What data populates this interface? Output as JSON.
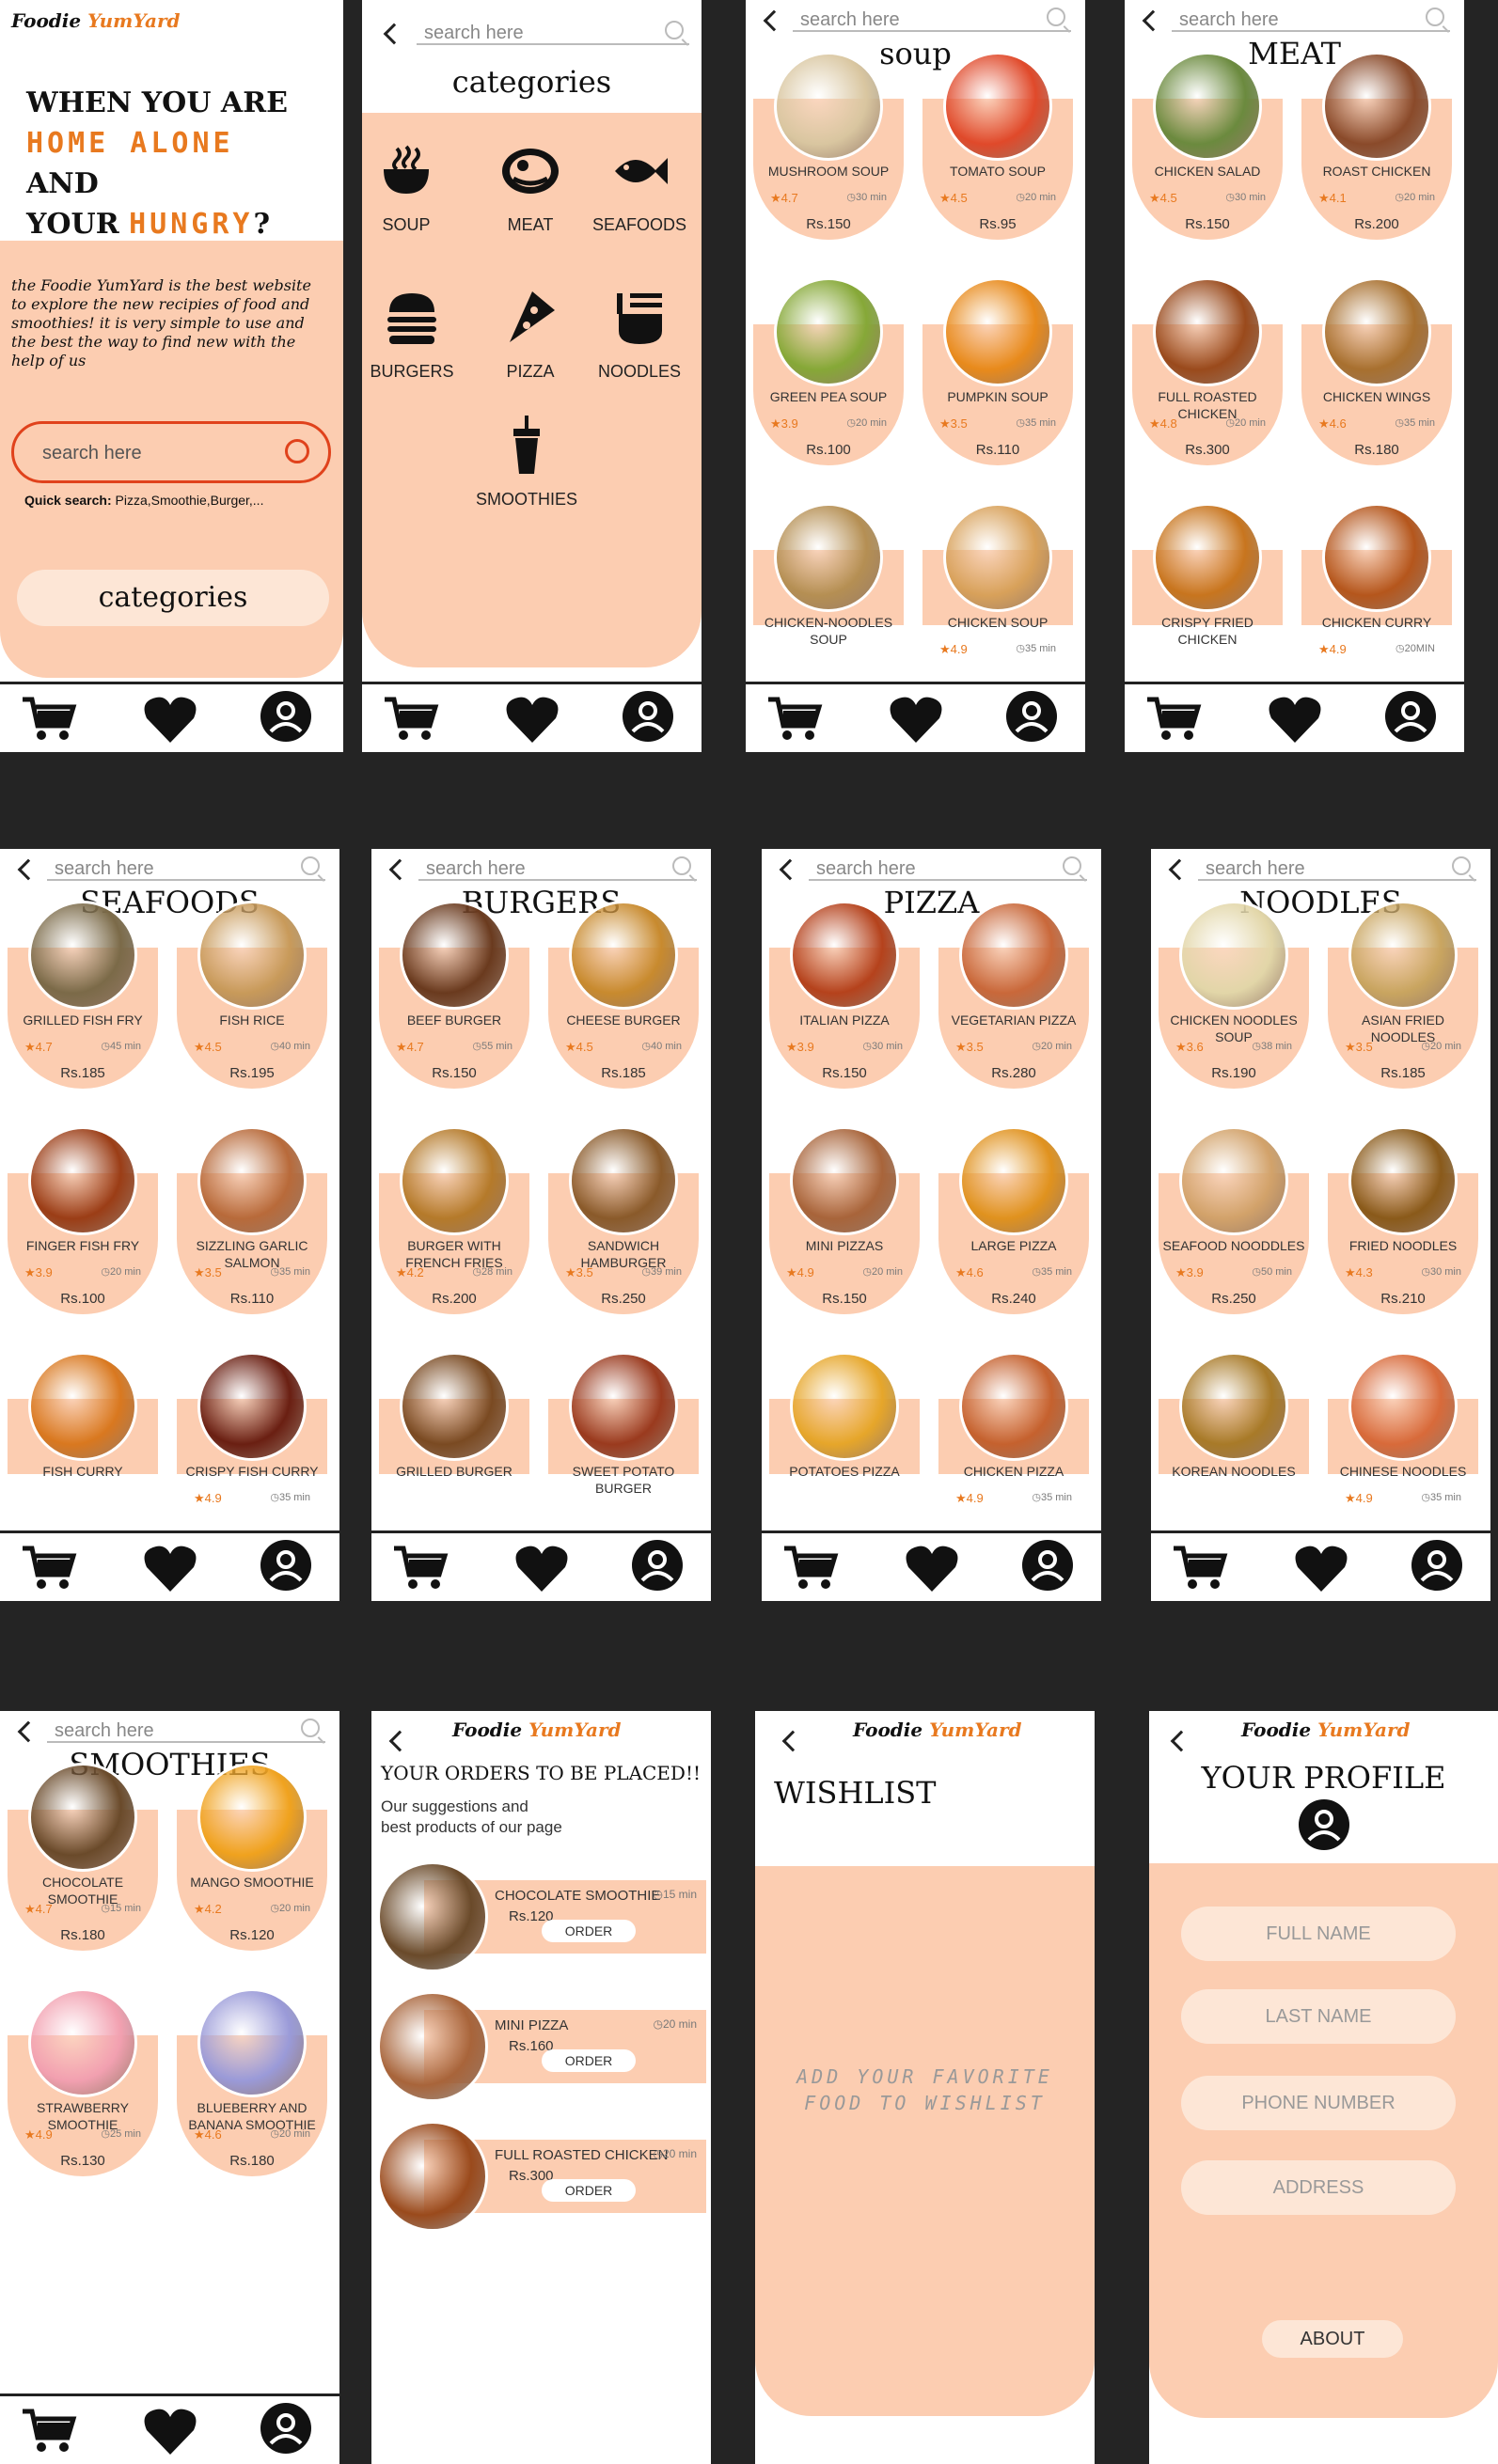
{
  "brand": {
    "part1": "Foodie ",
    "part2": "Yum",
    "part3": "Yard"
  },
  "home": {
    "headline": [
      "WHEN YOU ARE",
      "HOME ALONE",
      "AND",
      "YOUR",
      "HUNGRY",
      "?"
    ],
    "intro": "the Foodie YumYard is the best website to explore the new recipies of food and smoothies! it is very simple to use and the best the way to find new with the help of us",
    "search_placeholder": "search here",
    "quick_label": "Quick search:",
    "quick_items": "Pizza,Smoothie,Burger,...",
    "categories_button": "categories"
  },
  "search_placeholder": "search here",
  "categories_screen": {
    "title": "categories",
    "items": [
      {
        "label": "SOUP",
        "icon": "soup-bowl-icon"
      },
      {
        "label": "MEAT",
        "icon": "meat-icon"
      },
      {
        "label": "SEAFOODS",
        "icon": "fish-icon"
      },
      {
        "label": "BURGERS",
        "icon": "burger-icon"
      },
      {
        "label": "PIZZA",
        "icon": "pizza-icon"
      },
      {
        "label": "NOODLES",
        "icon": "noodles-icon"
      },
      {
        "label": "SMOOTHIES",
        "icon": "smoothie-cup-icon"
      }
    ]
  },
  "lists": [
    {
      "title": "soup",
      "items": [
        {
          "name": "MUSHROOM SOUP",
          "rating": "4.7",
          "time": "30 min",
          "price": "Rs.150",
          "color": "#d9c6a0"
        },
        {
          "name": "TOMATO SOUP",
          "rating": "4.5",
          "time": "20 min",
          "price": "Rs.95",
          "color": "#e0492a"
        },
        {
          "name": "GREEN PEA SOUP",
          "rating": "3.9",
          "time": "20 min",
          "price": "Rs.100",
          "color": "#86a837"
        },
        {
          "name": "PUMPKIN SOUP",
          "rating": "3.5",
          "time": "35 min",
          "price": "Rs.110",
          "color": "#e88a1b"
        },
        {
          "name": "CHICKEN-NOODLES SOUP",
          "rating": "",
          "time": "",
          "price": "",
          "color": "#b58f53"
        },
        {
          "name": "CHICKEN SOUP",
          "rating": "4.9",
          "time": "35 min",
          "price": "",
          "color": "#d8a15a"
        }
      ]
    },
    {
      "title": "MEAT",
      "items": [
        {
          "name": "CHICKEN SALAD",
          "rating": "4.5",
          "time": "30 min",
          "price": "Rs.150",
          "color": "#6b8a3e"
        },
        {
          "name": "ROAST CHICKEN",
          "rating": "4.1",
          "time": "20 min",
          "price": "Rs.200",
          "color": "#8a4a2a"
        },
        {
          "name": "FULL ROASTED CHICKEN",
          "rating": "4.8",
          "time": "20 min",
          "price": "Rs.300",
          "color": "#9a4a1c"
        },
        {
          "name": "CHICKEN WINGS",
          "rating": "4.6",
          "time": "35 min",
          "price": "Rs.180",
          "color": "#a8702f"
        },
        {
          "name": "CRISPY FRIED CHICKEN",
          "rating": "",
          "time": "",
          "price": "",
          "color": "#c8751e"
        },
        {
          "name": "CHICKEN CURRY",
          "rating": "4.9",
          "time": "20MIN",
          "price": "",
          "color": "#b5561c"
        }
      ]
    },
    {
      "title": "SEAFOODS",
      "items": [
        {
          "name": "GRILLED FISH FRY",
          "rating": "4.7",
          "time": "45 min",
          "price": "Rs.185",
          "color": "#7b6a48"
        },
        {
          "name": "FISH RICE",
          "rating": "4.5",
          "time": "40 min",
          "price": "Rs.195",
          "color": "#c89a5a"
        },
        {
          "name": "FINGER FISH FRY",
          "rating": "3.9",
          "time": "20 min",
          "price": "Rs.100",
          "color": "#9b3d16"
        },
        {
          "name": "SIZZLING GARLIC SALMON",
          "rating": "3.5",
          "time": "35 min",
          "price": "Rs.110",
          "color": "#b86a3a"
        },
        {
          "name": "FISH CURRY",
          "rating": "",
          "time": "",
          "price": "",
          "color": "#d9781f"
        },
        {
          "name": "CRISPY FISH CURRY",
          "rating": "4.9",
          "time": "35 min",
          "price": "",
          "color": "#6a1f12"
        }
      ]
    },
    {
      "title": "BURGERS",
      "items": [
        {
          "name": "BEEF BURGER",
          "rating": "4.7",
          "time": "55 min",
          "price": "Rs.150",
          "color": "#6a3a1e"
        },
        {
          "name": "CHEESE BURGER",
          "rating": "4.5",
          "time": "40 min",
          "price": "Rs.185",
          "color": "#c88a2e"
        },
        {
          "name": "BURGER WITH FRENCH FRIES",
          "rating": "4.2",
          "time": "28 min",
          "price": "Rs.200",
          "color": "#b57a2a"
        },
        {
          "name": "SANDWICH HAMBURGER",
          "rating": "3.5",
          "time": "39 min",
          "price": "Rs.250",
          "color": "#8a5a2a"
        },
        {
          "name": "GRILLED BURGER",
          "rating": "",
          "time": "",
          "price": "",
          "color": "#7a4a22"
        },
        {
          "name": "SWEET POTATO BURGER",
          "rating": "",
          "time": "",
          "price": "",
          "color": "#9a3a1e"
        }
      ]
    },
    {
      "title": "PIZZA",
      "items": [
        {
          "name": "ITALIAN PIZZA",
          "rating": "3.9",
          "time": "30 min",
          "price": "Rs.150",
          "color": "#b5421c"
        },
        {
          "name": "VEGETARIAN PIZZA",
          "rating": "3.5",
          "time": "20 min",
          "price": "Rs.280",
          "color": "#c9683a"
        },
        {
          "name": "MINI PIZZAS",
          "rating": "4.9",
          "time": "20 min",
          "price": "Rs.150",
          "color": "#a8643a"
        },
        {
          "name": "LARGE PIZZA",
          "rating": "4.6",
          "time": "35 min",
          "price": "Rs.240",
          "color": "#e0921e"
        },
        {
          "name": "POTATOES PIZZA",
          "rating": "",
          "time": "",
          "price": "",
          "color": "#e6a62a"
        },
        {
          "name": "CHICKEN PIZZA",
          "rating": "4.9",
          "time": "35 min",
          "price": "",
          "color": "#c5612e"
        }
      ]
    },
    {
      "title": "NOODLES",
      "items": [
        {
          "name": "CHICKEN NOODLES SOUP",
          "rating": "3.6",
          "time": "38 min",
          "price": "Rs.190",
          "color": "#e2d6a8"
        },
        {
          "name": "ASIAN FRIED NOODLES",
          "rating": "3.5",
          "time": "20 min",
          "price": "Rs.185",
          "color": "#c9a560"
        },
        {
          "name": "SEAFOOD NOODDLES",
          "rating": "3.9",
          "time": "50 min",
          "price": "Rs.250",
          "color": "#d2a26a"
        },
        {
          "name": "FRIED NOODLES",
          "rating": "4.3",
          "time": "30 min",
          "price": "Rs.210",
          "color": "#8a5a1a"
        },
        {
          "name": "KOREAN NOODLES",
          "rating": "",
          "time": "",
          "price": "",
          "color": "#a87a28"
        },
        {
          "name": "CHINESE NOODLES",
          "rating": "4.9",
          "time": "35 min",
          "price": "",
          "color": "#d86a3a"
        }
      ]
    },
    {
      "title": "SMOOTHIES",
      "items": [
        {
          "name": "CHOCOLATE SMOOTHIE",
          "rating": "4.7",
          "time": "15 min",
          "price": "Rs.180",
          "color": "#6a4a2a"
        },
        {
          "name": "MANGO SMOOTHIE",
          "rating": "4.2",
          "time": "20 min",
          "price": "Rs.120",
          "color": "#f0a21e"
        },
        {
          "name": "STRAWBERRY SMOOTHIE",
          "rating": "4.9",
          "time": "25 min",
          "price": "Rs.130",
          "color": "#f2a0b0"
        },
        {
          "name": "BLUEBERRY AND BANANA SMOOTHIE",
          "rating": "4.6",
          "time": "20 min",
          "price": "Rs.180",
          "color": "#9a9ad8"
        }
      ]
    }
  ],
  "orders": {
    "title": "YOUR ORDERS TO BE PLACED!!",
    "subtitle1": "Our suggestions and",
    "subtitle2": "best products of our page",
    "order_button": "ORDER",
    "items": [
      {
        "name": "CHOCOLATE SMOOTHIE",
        "price": "Rs.120",
        "time": "15 min",
        "color": "#6a4a2a"
      },
      {
        "name": "MINI PIZZA",
        "price": "Rs.160",
        "time": "20 min",
        "color": "#a8643a"
      },
      {
        "name": "FULL ROASTED CHICKEN",
        "price": "Rs.300",
        "time": "20 min",
        "color": "#9a4a1c"
      }
    ]
  },
  "wishlist": {
    "title": "WISHLIST",
    "empty_line1": "ADD YOUR FAVORITE",
    "empty_line2": "FOOD TO WISHLIST"
  },
  "profile": {
    "title": "YOUR PROFILE",
    "fields": [
      "FULL NAME",
      "LAST NAME",
      "PHONE NUMBER",
      "ADDRESS"
    ],
    "about_button": "ABOUT"
  },
  "colors": {
    "accent": "#e8791f",
    "peach": "#fccdb1",
    "background": "#242424"
  }
}
